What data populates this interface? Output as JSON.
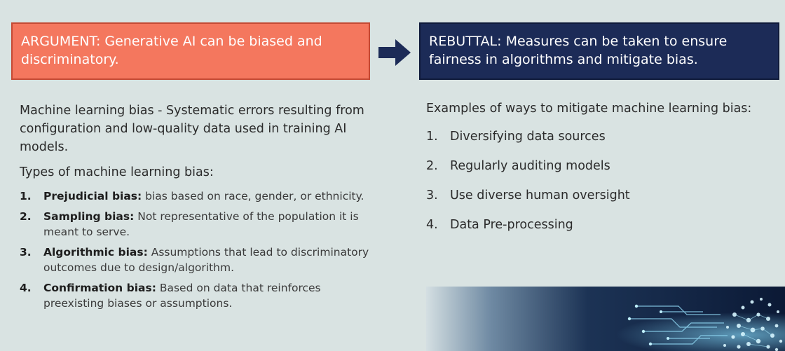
{
  "argument": {
    "text": "ARGUMENT: Generative AI can be biased and discriminatory."
  },
  "rebuttal": {
    "text": "REBUTTAL: Measures can be taken to ensure fairness in algorithms and mitigate bias."
  },
  "arrow_icon": "right-arrow-icon",
  "colors": {
    "background": "#d9e3e2",
    "argument_box": "#f4775e",
    "rebuttal_box": "#1c2b57",
    "arrow": "#1c2b57"
  },
  "left": {
    "definition": "Machine learning bias - Systematic errors resulting from configuration and low-quality data used in training AI models.",
    "types_heading": "Types of machine learning bias:",
    "biases": [
      {
        "num": "1.",
        "term": "Prejudicial bias:",
        "desc": " bias based on race, gender, or ethnicity."
      },
      {
        "num": "2.",
        "term": "Sampling bias:",
        "desc": " Not representative of the population it is meant to serve."
      },
      {
        "num": "3.",
        "term": "Algorithmic bias:",
        "desc": " Assumptions that lead to discriminatory outcomes due to design/algorithm."
      },
      {
        "num": "4.",
        "term": "Confirmation bias:",
        "desc": " Based on data that reinforces preexisting biases or assumptions."
      }
    ]
  },
  "right": {
    "intro": "Examples of ways to mitigate machine learning bias:",
    "items": [
      {
        "num": "1.",
        "text": "Diversifying data sources"
      },
      {
        "num": "2.",
        "text": "Regularly auditing models"
      },
      {
        "num": "3.",
        "text": "Use diverse human oversight"
      },
      {
        "num": "4.",
        "text": "Data Pre-processing"
      }
    ]
  }
}
